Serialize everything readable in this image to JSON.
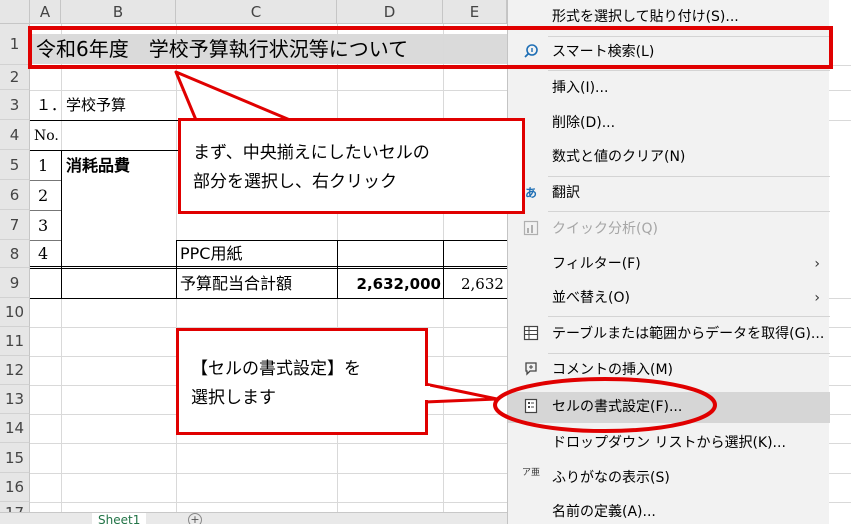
{
  "columns": [
    "A",
    "B",
    "C",
    "D",
    "E"
  ],
  "rows": [
    "1",
    "2",
    "3",
    "4",
    "5",
    "6",
    "7",
    "8",
    "9",
    "10",
    "11",
    "12",
    "13",
    "14",
    "15",
    "16",
    "17"
  ],
  "sheet": {
    "title": "令和6年度　学校予算執行状況等について",
    "section": "１．学校予算",
    "no_header": "No.",
    "item_nos": [
      "1",
      "2",
      "3",
      "4"
    ],
    "category": "消耗品費",
    "item_ppc": "PPC用紙",
    "total_label": "予算配当合計額",
    "total_d": "2,632,000",
    "total_e": "2,632",
    "tab_name": "Sheet1",
    "add_sheet": "+"
  },
  "context_menu": {
    "items": [
      {
        "label": "形式を選択して貼り付け(S)...",
        "icon": ""
      },
      {
        "label": "スマート検索(L)",
        "icon": "search-icon"
      },
      {
        "label": "挿入(I)...",
        "icon": ""
      },
      {
        "label": "削除(D)...",
        "icon": ""
      },
      {
        "label": "数式と値のクリア(N)",
        "icon": ""
      },
      {
        "label": "翻訳",
        "icon": "translate-icon"
      },
      {
        "label": "クイック分析(Q)",
        "icon": "quick-analysis-icon"
      },
      {
        "label": "フィルター(F)",
        "icon": ""
      },
      {
        "label": "並べ替え(O)",
        "icon": ""
      },
      {
        "label": "テーブルまたは範囲からデータを取得(G)...",
        "icon": "table-icon"
      },
      {
        "label": "コメントの挿入(M)",
        "icon": "comment-icon"
      },
      {
        "label": "セルの書式設定(F)...",
        "icon": "format-cells-icon"
      },
      {
        "label": "ドロップダウン リストから選択(K)...",
        "icon": ""
      },
      {
        "label": "ふりがなの表示(S)",
        "icon": "furigana-icon"
      },
      {
        "label": "名前の定義(A)...",
        "icon": ""
      }
    ],
    "submenu_arrow": "›",
    "translate_glyph": "あ",
    "furigana_glyph": "ア亜"
  },
  "callouts": {
    "first": {
      "line1": "まず、中央揃えにしたいセルの",
      "line2": "部分を選択し、右クリック"
    },
    "second": {
      "line1": "【セルの書式設定】を",
      "line2": "選択します"
    }
  },
  "colors": {
    "accent": "#e00000",
    "menu_bg": "#f2f2f2",
    "highlight": "#d6d6d6",
    "tab_green": "#217346"
  }
}
